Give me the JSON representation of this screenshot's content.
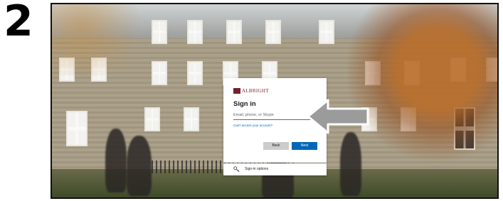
{
  "step_number": "2",
  "signin_card": {
    "logo_text": "ALBRIGHT",
    "title": "Sign in",
    "email_placeholder": "Email, phone, or Skype",
    "cant_access_link": "Can't access your account?",
    "back_label": "Back",
    "next_label": "Next"
  },
  "signin_options": {
    "label": "Sign-in options",
    "icon": "key-icon"
  },
  "annotation": {
    "icon": "arrow-pointing-left",
    "color": "#ffffff"
  },
  "colors": {
    "brand": "#7a1f2b",
    "primary_button": "#0067b8",
    "secondary_button": "#cccccc",
    "link": "#0067b8"
  }
}
